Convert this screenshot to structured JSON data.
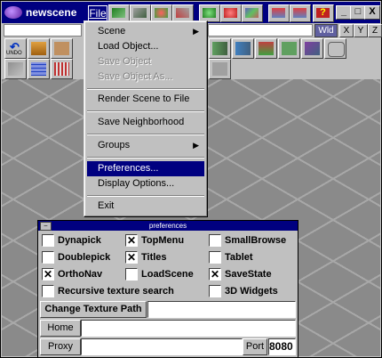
{
  "window": {
    "title": "newscene",
    "file_menu_label": "File",
    "min_label": "_",
    "max_label": "□",
    "close_label": "X"
  },
  "axis": {
    "wld": "Wld",
    "x": "X",
    "y": "Y",
    "z": "Z"
  },
  "toolbar": {
    "undo_label": "UNDO"
  },
  "menu": {
    "items": [
      {
        "label": "Scene",
        "submenu": true
      },
      {
        "label": "Load Object...",
        "submenu": false
      },
      {
        "label": "Save Object",
        "disabled": true
      },
      {
        "label": "Save Object As...",
        "disabled": true
      },
      {
        "label": "Render Scene to File"
      },
      {
        "label": "Save Neighborhood"
      },
      {
        "label": "Groups",
        "submenu": true
      },
      {
        "label": "Preferences...",
        "selected": true
      },
      {
        "label": "Display Options..."
      },
      {
        "label": "Exit"
      }
    ]
  },
  "prefs": {
    "title": "preferences",
    "close_label": "–",
    "checkboxes": [
      {
        "label": "Dynapick",
        "checked": false
      },
      {
        "label": "TopMenu",
        "checked": true
      },
      {
        "label": "SmallBrowse",
        "checked": false
      },
      {
        "label": "Doublepick",
        "checked": false
      },
      {
        "label": "Titles",
        "checked": true
      },
      {
        "label": "Tablet",
        "checked": false
      },
      {
        "label": "OrthoNav",
        "checked": true
      },
      {
        "label": "LoadScene",
        "checked": false
      },
      {
        "label": "SaveState",
        "checked": true
      },
      {
        "label": "Recursive texture search",
        "checked": false
      },
      {
        "label": "3D Widgets",
        "checked": false
      }
    ],
    "change_texture_path": "Change Texture Path",
    "texture_path_value": "",
    "home_label": "Home",
    "home_value": "",
    "proxy_label": "Proxy",
    "proxy_value": "",
    "port_label": "Port",
    "port_value": "8080"
  }
}
